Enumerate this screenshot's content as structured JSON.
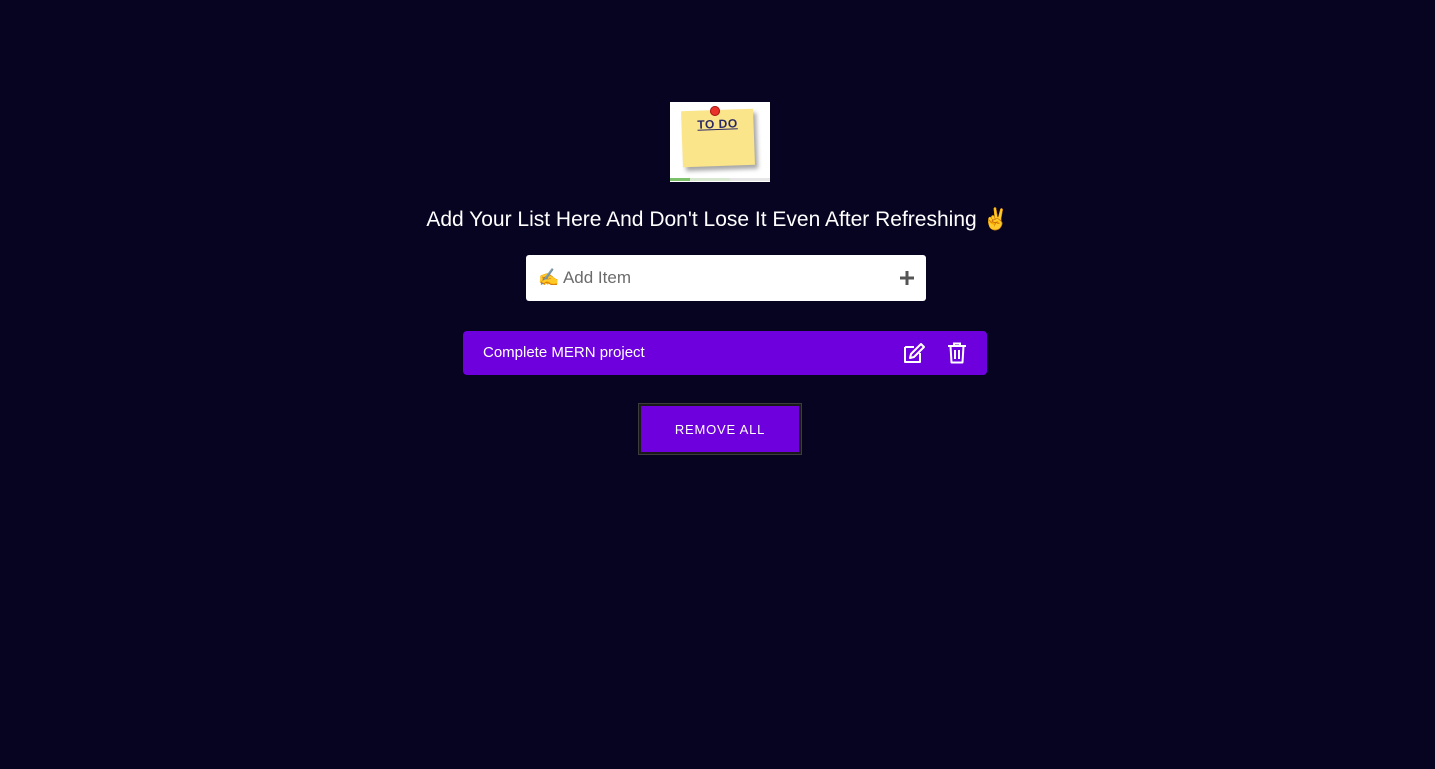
{
  "logo": {
    "text": "TO DO"
  },
  "heading": "Add Your List Here And Don't Lose It Even After Refreshing ✌️",
  "add_item": {
    "placeholder": "✍️ Add Item",
    "value": "",
    "add_icon": "plus-icon"
  },
  "items": [
    {
      "label": "Complete MERN project",
      "edit_icon": "edit-icon",
      "delete_icon": "trash-icon"
    }
  ],
  "remove_all_label": "REMOVE ALL",
  "colors": {
    "background": "#060421",
    "accent": "#6e00de",
    "text": "#ffffff"
  }
}
